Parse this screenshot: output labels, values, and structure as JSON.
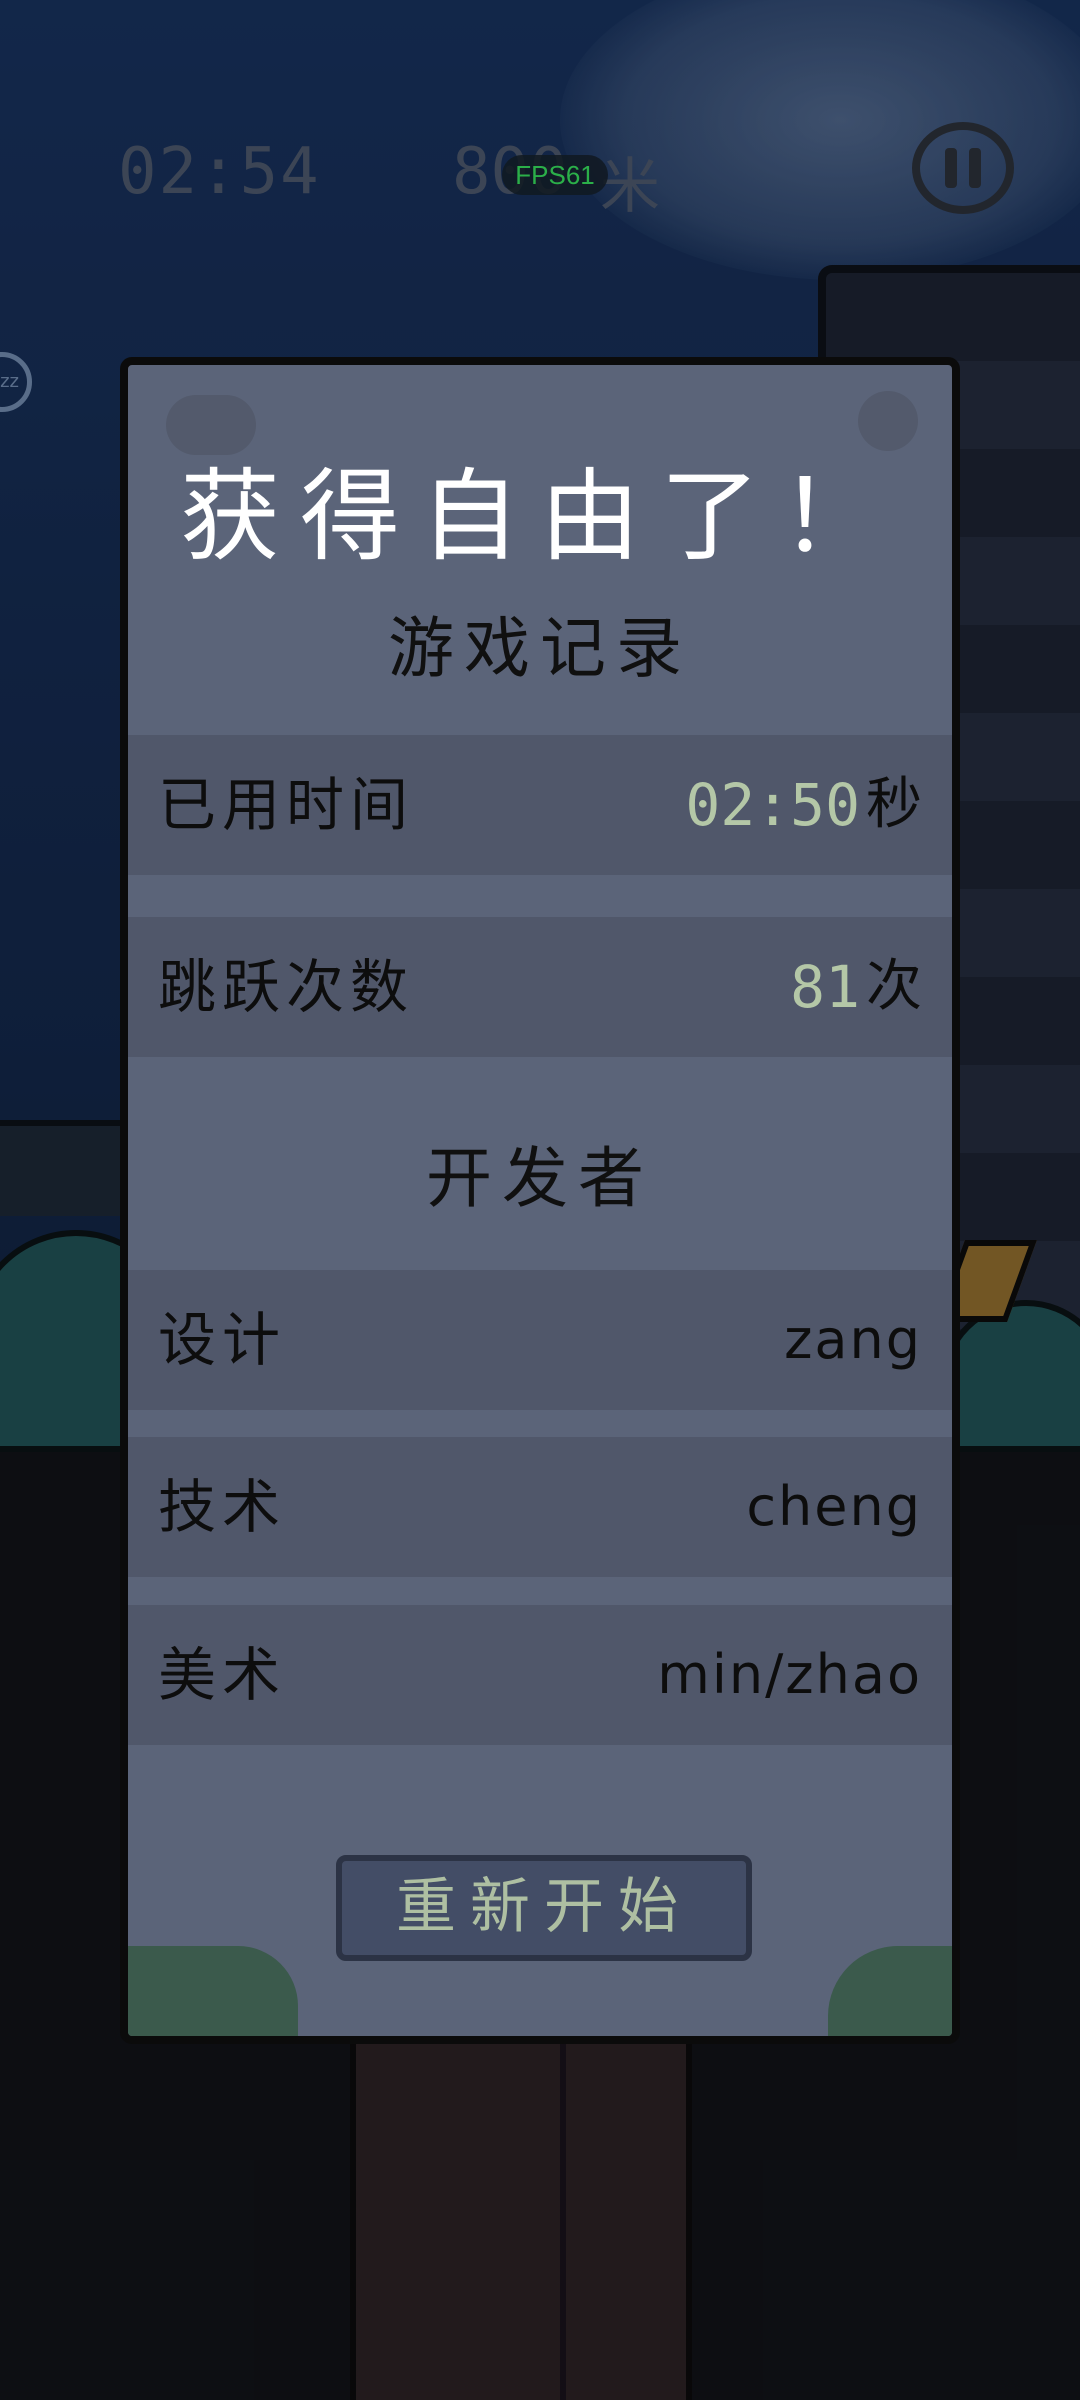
{
  "hud": {
    "time": "02:54",
    "distance": "800",
    "distance_unit": "米",
    "fps": "FPS61",
    "zz": "zz"
  },
  "panel": {
    "title": "获得自由了！",
    "records_heading": "游戏记录",
    "records": [
      {
        "label": "已用时间",
        "value": "02:50",
        "unit": "秒"
      },
      {
        "label": "跳跃次数",
        "value": "81",
        "unit": "次"
      }
    ],
    "developers_heading": "开发者",
    "developers": [
      {
        "role": "设计",
        "name": "zang"
      },
      {
        "role": "技术",
        "name": "cheng"
      },
      {
        "role": "美术",
        "name": "min/zhao"
      }
    ],
    "restart_label": "重新开始"
  },
  "colors": {
    "panel_bg": "#5b6479",
    "row_bg": "#50576a",
    "value_accent": "#b4c7a7",
    "button_bg": "#434d66",
    "fps_green": "#35d65a"
  }
}
